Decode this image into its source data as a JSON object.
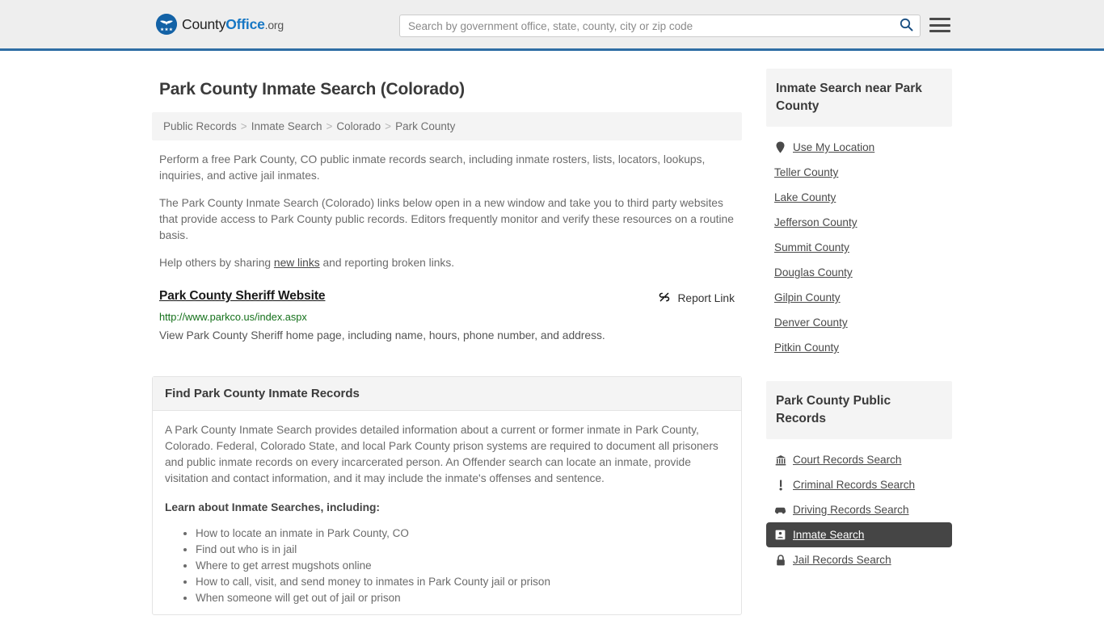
{
  "header": {
    "logo": {
      "icon": "eagle-shield-logo-icon",
      "part1": "County",
      "part2": "Office",
      "part3": ".org"
    },
    "search": {
      "placeholder": "Search by government office, state, county, city or zip code",
      "value": "",
      "button_icon": "search-icon"
    },
    "menu_icon": "hamburger-menu-icon",
    "accent_color": "#2e6da4",
    "background_color": "#eeeeee"
  },
  "page": {
    "title": "Park County Inmate Search (Colorado)"
  },
  "breadcrumb": {
    "separator": ">",
    "items": [
      {
        "label": "Public Records"
      },
      {
        "label": "Inmate Search"
      },
      {
        "label": "Colorado"
      },
      {
        "label": "Park County"
      }
    ]
  },
  "intro": {
    "paragraph1": "Perform a free Park County, CO public inmate records search, including inmate rosters, lists, locators, lookups, inquiries, and active jail inmates.",
    "paragraph2": "The Park County Inmate Search (Colorado) links below open in a new window and take you to third party websites that provide access to Park County public records. Editors frequently monitor and verify these resources on a routine basis.",
    "paragraph3_pre": "Help others by sharing ",
    "paragraph3_link": "new links",
    "paragraph3_post": " and reporting broken links."
  },
  "result_link": {
    "title": "Park County Sheriff Website",
    "url": "http://www.parkco.us/index.aspx",
    "description": "View Park County Sheriff home page, including name, hours, phone number, and address.",
    "report": {
      "label": "Report Link",
      "icon": "broken-link-icon"
    },
    "url_color": "#14701a"
  },
  "panel": {
    "heading": "Find Park County Inmate Records",
    "paragraph": "A Park County Inmate Search provides detailed information about a current or former inmate in Park County, Colorado. Federal, Colorado State, and local Park County prison systems are required to document all prisoners and public inmate records on every incarcerated person. An Offender search can locate an inmate, provide visitation and contact information, and it may include the inmate's offenses and sentence.",
    "list_heading": "Learn about Inmate Searches, including:",
    "list_items": [
      "How to locate an inmate in Park County, CO",
      "Find out who is in jail",
      "Where to get arrest mugshots online",
      "How to call, visit, and send money to inmates in Park County jail or prison",
      "When someone will get out of jail or prison"
    ]
  },
  "sidebar": {
    "nearby": {
      "heading": "Inmate Search near Park County",
      "items": [
        {
          "label": "Use My Location",
          "icon": "map-pin-icon",
          "active": false
        },
        {
          "label": "Teller County",
          "icon": "",
          "active": false
        },
        {
          "label": "Lake County",
          "icon": "",
          "active": false
        },
        {
          "label": "Jefferson County",
          "icon": "",
          "active": false
        },
        {
          "label": "Summit County",
          "icon": "",
          "active": false
        },
        {
          "label": "Douglas County",
          "icon": "",
          "active": false
        },
        {
          "label": "Gilpin County",
          "icon": "",
          "active": false
        },
        {
          "label": "Denver County",
          "icon": "",
          "active": false
        },
        {
          "label": "Pitkin County",
          "icon": "",
          "active": false
        }
      ]
    },
    "public_records": {
      "heading": "Park County Public Records",
      "items": [
        {
          "label": "Court Records Search",
          "icon": "courthouse-icon",
          "active": false
        },
        {
          "label": "Criminal Records Search",
          "icon": "exclamation-icon",
          "active": false
        },
        {
          "label": "Driving Records Search",
          "icon": "car-icon",
          "active": false
        },
        {
          "label": "Inmate Search",
          "icon": "id-card-icon",
          "active": true
        },
        {
          "label": "Jail Records Search",
          "icon": "lock-icon",
          "active": false
        }
      ],
      "active_background": "#454545"
    }
  }
}
